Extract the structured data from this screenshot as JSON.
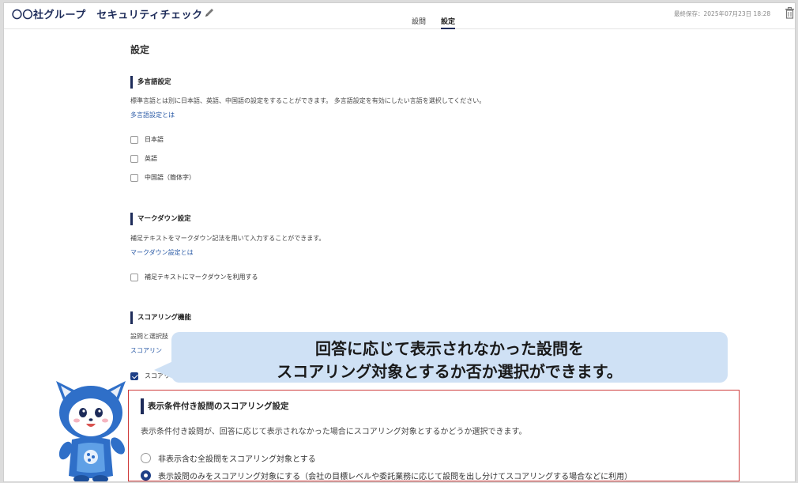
{
  "header": {
    "title": "〇〇社グループ　セキュリティチェック",
    "tabs": [
      {
        "label": "設問"
      },
      {
        "label": "設定"
      }
    ],
    "saved": "最終保存：2025年07月23日 18:28"
  },
  "page": {
    "title": "設定"
  },
  "sections": {
    "multilang": {
      "heading": "多言語設定",
      "desc": "標準言語とは別に日本語、英語、中国語の設定をすることができます。 多言語設定を有効にしたい言語を選択してください。",
      "link": "多言語設定とは",
      "options": [
        {
          "label": "日本語",
          "checked": false
        },
        {
          "label": "英語",
          "checked": false
        },
        {
          "label": "中国語（簡体字）",
          "checked": false
        }
      ]
    },
    "markdown": {
      "heading": "マークダウン設定",
      "desc": "補足テキストをマークダウン記法を用いて入力することができます。",
      "link": "マークダウン設定とは",
      "option": {
        "label": "補足テキストにマークダウンを利用する",
        "checked": false
      }
    },
    "scoring": {
      "heading": "スコアリング機能",
      "desc": "設問と選択肢",
      "link": "スコアリン",
      "option": {
        "label": "スコアリ",
        "checked": true
      }
    }
  },
  "callout": {
    "line1": "回答に応じて表示されなかった設問を",
    "line2": "スコアリング対象とするか否か選択ができます。",
    "color": "#cfe1f5"
  },
  "panel": {
    "heading": "表示条件付き設問のスコアリング設定",
    "desc": "表示条件付き設問が、回答に応じて表示されなかった場合にスコアリング対象とするかどうか選択できます。",
    "options": [
      {
        "label": "非表示含む全設問をスコアリング対象とする",
        "selected": false
      },
      {
        "label": "表示設問のみをスコアリング対象にする（会社の目標レベルや委託業務に応じて設問を出し分けてスコアリングする場合などに利用）",
        "selected": true
      }
    ],
    "border_color": "#cf3b3b"
  },
  "colors": {
    "brand": "#1d2b59",
    "link": "#2a5aa6",
    "checked": "#1d3f87"
  },
  "icons": [
    "pencil-icon",
    "trash-icon"
  ]
}
